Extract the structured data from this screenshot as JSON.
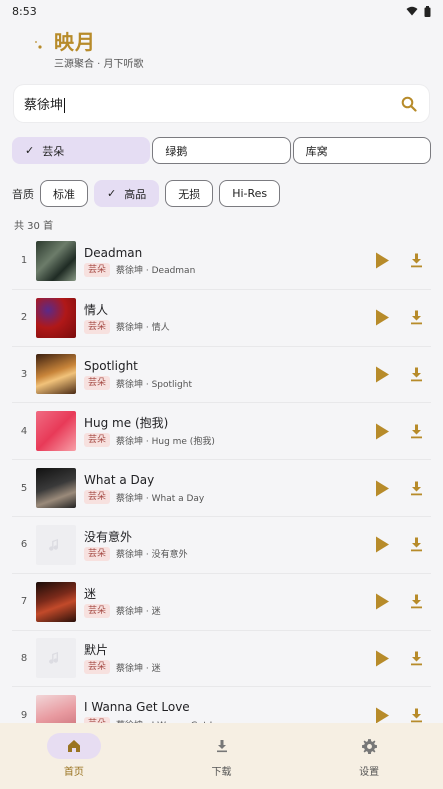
{
  "status": {
    "time": "8:53"
  },
  "app": {
    "title": "映月",
    "subtitle": "三源聚合 · 月下听歌"
  },
  "search": {
    "value": "蔡徐坤"
  },
  "sources": [
    {
      "label": "芸朵",
      "selected": true
    },
    {
      "label": "绿鹅",
      "selected": false
    },
    {
      "label": "库窝",
      "selected": false
    }
  ],
  "quality": {
    "label": "音质",
    "options": [
      {
        "label": "标准",
        "selected": false
      },
      {
        "label": "高品",
        "selected": true
      },
      {
        "label": "无损",
        "selected": false
      },
      {
        "label": "Hi-Res",
        "selected": false
      }
    ]
  },
  "results": {
    "count_label": "共 30 首",
    "songs": [
      {
        "index": "1",
        "title": "Deadman",
        "source_tag": "芸朵",
        "subtitle": "蔡徐坤 · Deadman",
        "cover": "photo"
      },
      {
        "index": "2",
        "title": "情人",
        "source_tag": "芸朵",
        "subtitle": "蔡徐坤 · 情人",
        "cover": "photo"
      },
      {
        "index": "3",
        "title": "Spotlight",
        "source_tag": "芸朵",
        "subtitle": "蔡徐坤 · Spotlight",
        "cover": "photo"
      },
      {
        "index": "4",
        "title": "Hug me (抱我)",
        "source_tag": "芸朵",
        "subtitle": "蔡徐坤 · Hug me (抱我)",
        "cover": "photo"
      },
      {
        "index": "5",
        "title": "What a Day",
        "source_tag": "芸朵",
        "subtitle": "蔡徐坤 · What a Day",
        "cover": "photo"
      },
      {
        "index": "6",
        "title": "没有意外",
        "source_tag": "芸朵",
        "subtitle": "蔡徐坤 · 没有意外",
        "cover": "placeholder"
      },
      {
        "index": "7",
        "title": "迷",
        "source_tag": "芸朵",
        "subtitle": "蔡徐坤 · 迷",
        "cover": "photo"
      },
      {
        "index": "8",
        "title": "默片",
        "source_tag": "芸朵",
        "subtitle": "蔡徐坤 · 迷",
        "cover": "placeholder"
      },
      {
        "index": "9",
        "title": "I Wanna Get Love",
        "source_tag": "芸朵",
        "subtitle": "蔡徐坤 · I Wanna Get Love",
        "cover": "photo"
      }
    ]
  },
  "nav": [
    {
      "label": "首页",
      "icon": "home-icon",
      "active": true
    },
    {
      "label": "下载",
      "icon": "download-icon",
      "active": false
    },
    {
      "label": "设置",
      "icon": "gear-icon",
      "active": false
    }
  ],
  "colors": {
    "accent": "#b78b2a",
    "tag_text": "#a54a44",
    "tag_bg": "#f7e1df",
    "selected_chip": "#e5ddf3",
    "nav_bg": "#f6efe3"
  }
}
